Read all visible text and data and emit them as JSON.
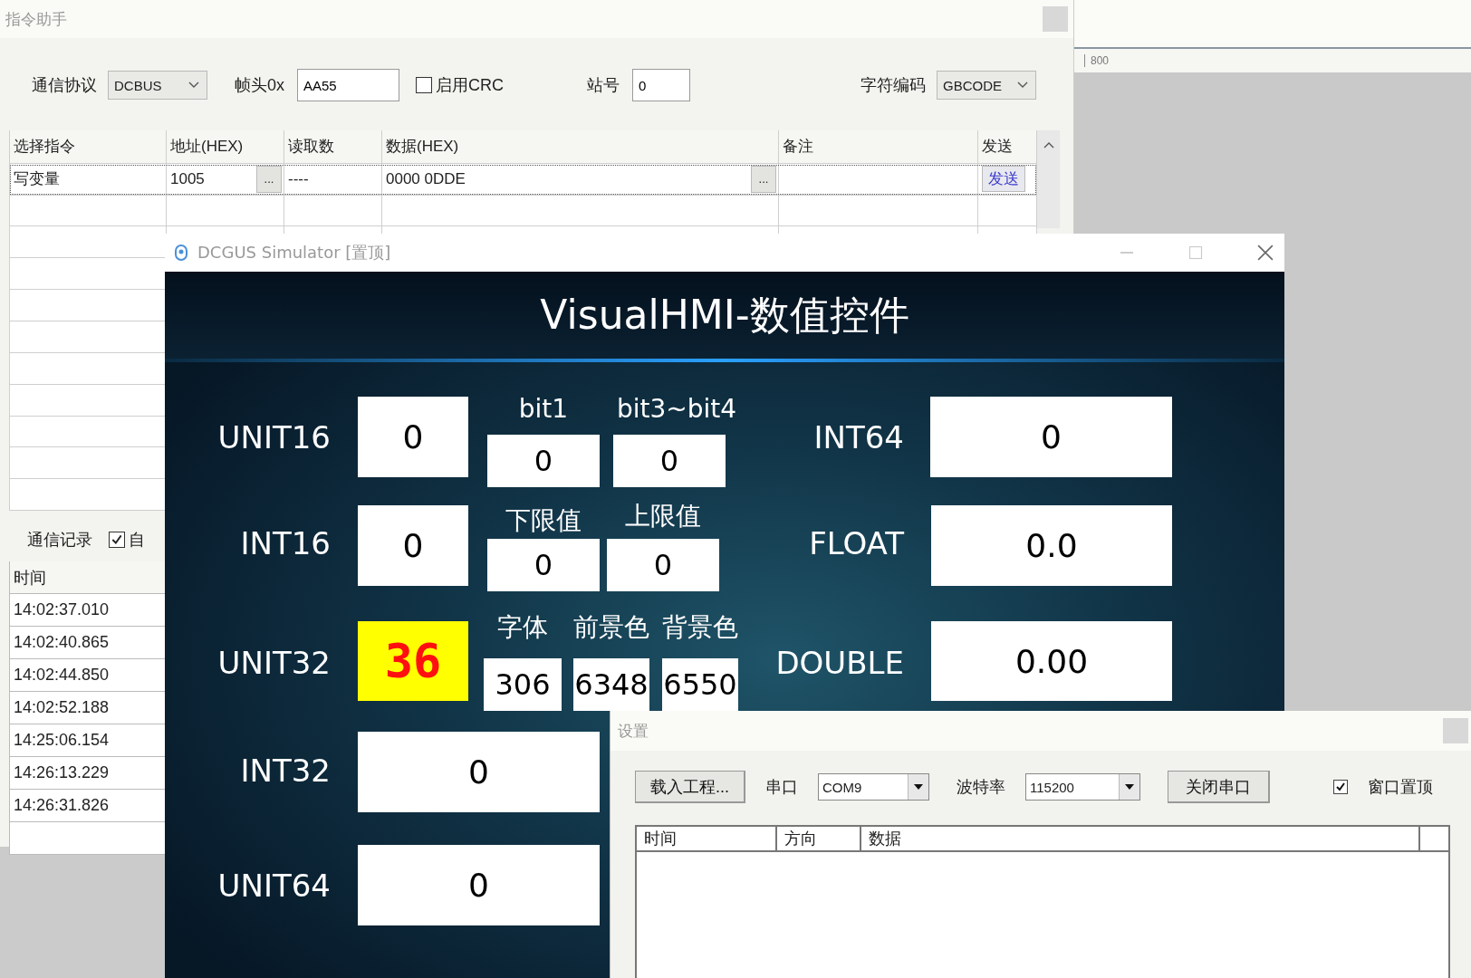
{
  "assistant_window": {
    "title": "指令助手",
    "protocol": {
      "label": "通信协议",
      "value": "DCBUS"
    },
    "frame_header": {
      "label": "帧头0x",
      "value": "AA55"
    },
    "crc": {
      "label": "启用CRC",
      "checked": false
    },
    "station": {
      "label": "站号",
      "value": "0"
    },
    "encoding": {
      "label": "字符编码",
      "value": "GBCODE"
    },
    "command_table": {
      "columns": [
        "选择指令",
        "地址(HEX)",
        "读取数",
        "数据(HEX)",
        "备注",
        "发送"
      ],
      "rows": [
        {
          "command": "写变量",
          "address": "1005",
          "address_button": "...",
          "read_count": "----",
          "data": "0000 0DDE",
          "data_button": "...",
          "send": "发送",
          "selected": true
        }
      ]
    },
    "log": {
      "label": "通信记录",
      "auto_checkbox": {
        "label": "自",
        "checked": true
      },
      "column": "时间",
      "rows": [
        "14:02:37.010",
        "14:02:40.865",
        "14:02:44.850",
        "14:02:52.188",
        "14:25:06.154",
        "14:26:13.229",
        "14:26:31.826"
      ]
    }
  },
  "background_ruler": {
    "value": "800"
  },
  "simulator": {
    "title": "DCGUS Simulator [置顶]",
    "heading": "VisualHMI-数值控件",
    "widgets": [
      {
        "label": "UNIT16",
        "value": "0",
        "kind": "big"
      },
      {
        "label": "bit1",
        "value": "0",
        "kind": "small"
      },
      {
        "label": "bit3~bit4",
        "value": "0",
        "kind": "small"
      },
      {
        "label": "INT64",
        "value": "0",
        "kind": "big"
      },
      {
        "label": "INT16",
        "value": "0",
        "kind": "big"
      },
      {
        "label": "下限值",
        "value": "0",
        "kind": "small"
      },
      {
        "label": "上限值",
        "value": "0",
        "kind": "small"
      },
      {
        "label": "FLOAT",
        "value": "0.0",
        "kind": "big"
      },
      {
        "label": "UNIT32",
        "value": "36",
        "kind": "led"
      },
      {
        "label": "字体",
        "value": "306",
        "kind": "small"
      },
      {
        "label": "前景色",
        "value": "6348",
        "kind": "small"
      },
      {
        "label": "背景色",
        "value": "6550",
        "kind": "small"
      },
      {
        "label": "DOUBLE",
        "value": "0.00",
        "kind": "big"
      },
      {
        "label": "INT32",
        "value": "0",
        "kind": "big"
      },
      {
        "label": "UNIT64",
        "value": "0",
        "kind": "big"
      }
    ]
  },
  "settings_window": {
    "title": "设置",
    "load_button": "载入工程...",
    "port": {
      "label": "串口",
      "value": "COM9"
    },
    "baud": {
      "label": "波特率",
      "value": "115200"
    },
    "close_port_button": "关闭串口",
    "stay_on_top": {
      "label": "窗口置顶",
      "checked": true
    },
    "columns": [
      "时间",
      "方向",
      "数据"
    ]
  }
}
